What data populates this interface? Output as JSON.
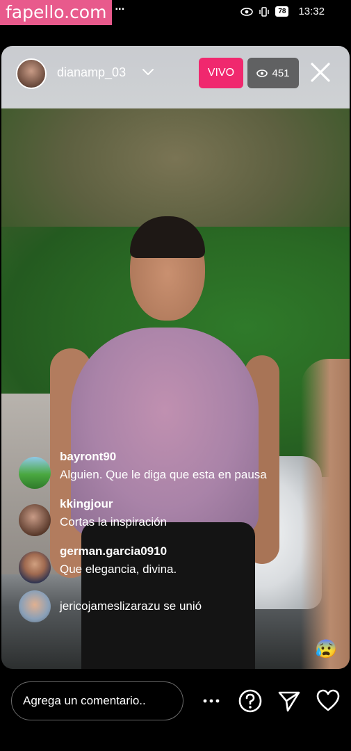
{
  "watermark": "fapello.com",
  "status_bar": {
    "battery": "78",
    "time": "13:32"
  },
  "header": {
    "username": "dianamp_03",
    "live_label": "VIVO",
    "viewer_count": "451"
  },
  "comments": [
    {
      "user": "bayront90",
      "text": "Alguien. Que le diga que esta en pausa"
    },
    {
      "user": "kkingjour",
      "text": "Cortas la inspiración"
    },
    {
      "user": "german.garcia0910",
      "text": "Que elegancia, divina."
    }
  ],
  "join_notice": "jericojameslizarazu se unió",
  "reaction_emoji": "😰",
  "composer": {
    "placeholder": "Agrega un comentario.."
  },
  "colors": {
    "live_badge": "#f0286e",
    "watermark_bg": "#e85a8c"
  },
  "icons": [
    "eye-icon",
    "vibrate-icon",
    "battery-icon",
    "chevron-down-icon",
    "close-icon",
    "more-icon",
    "question-icon",
    "send-icon",
    "heart-icon"
  ]
}
